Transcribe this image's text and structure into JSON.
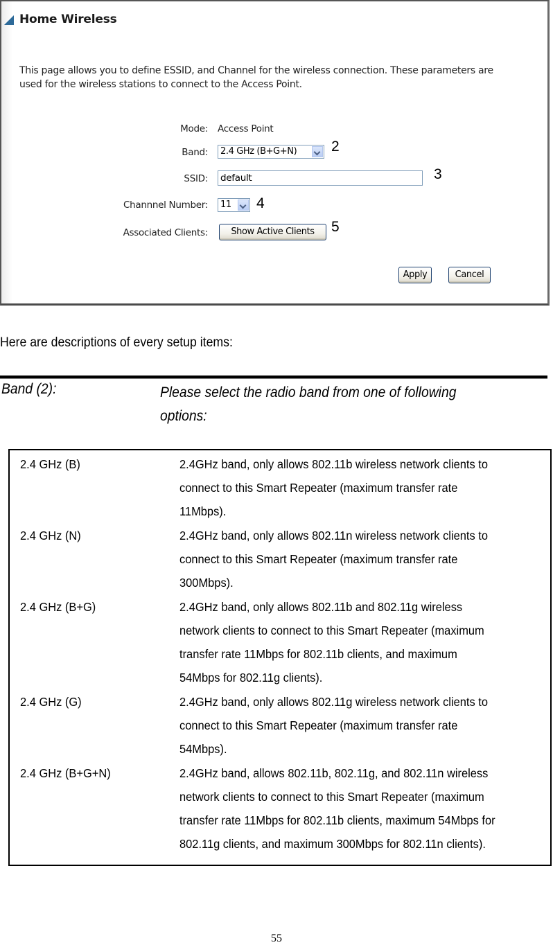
{
  "screenshot": {
    "title": "Home Wireless",
    "intro": "This page allows you to define ESSID, and Channel for the wireless connection. These parameters are used for the wireless stations to connect to the Access Point.",
    "fields": {
      "mode_label": "Mode:",
      "mode_value": "Access Point",
      "band_label": "Band:",
      "band_selected": "2.4 GHz (B+G+N)",
      "ssid_label": "SSID:",
      "ssid_value": "default",
      "channel_label": "Channnel Number:",
      "channel_selected": "11",
      "clients_label": "Associated Clients:",
      "clients_button": "Show Active Clients"
    },
    "buttons": {
      "apply": "Apply",
      "cancel": "Cancel"
    },
    "callouts": {
      "band": "2",
      "ssid": "3",
      "channel": "4",
      "clients": "5"
    },
    "colors": {
      "accent_triangle": "#2d6a99",
      "input_border": "#7f9db9",
      "button_border": "#1c3f6e"
    }
  },
  "document": {
    "intro": "Here are descriptions of every setup items:",
    "band_term": "Band (2):",
    "band_description_lines": [
      "Please select the radio band from one of following",
      "options:"
    ],
    "options": [
      {
        "name": "2.4 GHz (B)",
        "lines": [
          "2.4GHz band, only allows 802.11b wireless network clients to",
          "connect to this Smart Repeater (maximum transfer rate",
          "11Mbps)."
        ]
      },
      {
        "name": "2.4 GHz (N)",
        "lines": [
          "2.4GHz band, only allows 802.11n wireless network clients to",
          "connect to this Smart Repeater (maximum transfer rate",
          "300Mbps)."
        ]
      },
      {
        "name": "2.4 GHz (B+G)",
        "lines": [
          "2.4GHz band, only allows 802.11b and 802.11g wireless",
          "network clients to connect to this Smart Repeater (maximum",
          "transfer rate 11Mbps for 802.11b clients, and maximum",
          "54Mbps for 802.11g clients)."
        ]
      },
      {
        "name": "2.4 GHz (G)",
        "lines": [
          "2.4GHz band, only allows 802.11g wireless network clients to",
          "connect to this Smart Repeater (maximum transfer rate",
          "54Mbps)."
        ]
      },
      {
        "name": "2.4 GHz (B+G+N)",
        "lines": [
          "2.4GHz band, allows 802.11b, 802.11g, and 802.11n wireless",
          "network clients to connect to this Smart Repeater (maximum",
          "transfer rate 11Mbps for 802.11b clients, maximum 54Mbps for",
          "802.11g clients, and maximum 300Mbps for 802.11n clients)."
        ]
      }
    ],
    "page_number": "55"
  }
}
